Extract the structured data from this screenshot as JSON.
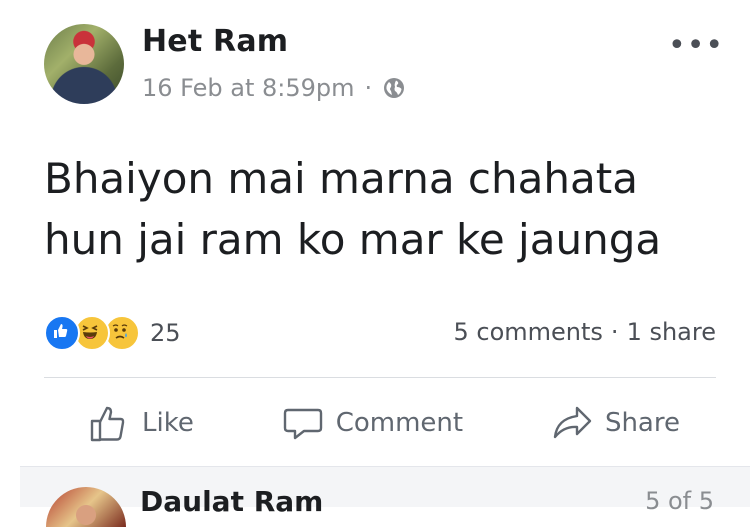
{
  "post": {
    "author": "Het Ram",
    "date": "16 Feb at 8:59pm",
    "separator": "·",
    "audience_icon": "globe-icon",
    "more_label": "•••",
    "text": "Bhaiyon mai marna chahata\nhun jai ram ko mar ke jaunga",
    "reactions": {
      "icons": [
        "like-reaction-icon",
        "haha-reaction-icon",
        "sad-reaction-icon"
      ],
      "count": "25"
    },
    "comments": "5 comments",
    "stat_separator": "·",
    "shares": "1 share"
  },
  "actions": {
    "like": "Like",
    "comment": "Comment",
    "share": "Share"
  },
  "next_post": {
    "author": "Daulat Ram",
    "counter": "5 of 5"
  },
  "colors": {
    "like_blue": "#1877f2",
    "emoji_yellow": "#f7c53b",
    "secondary_text": "#8a8d91",
    "divider": "#dadde1"
  }
}
